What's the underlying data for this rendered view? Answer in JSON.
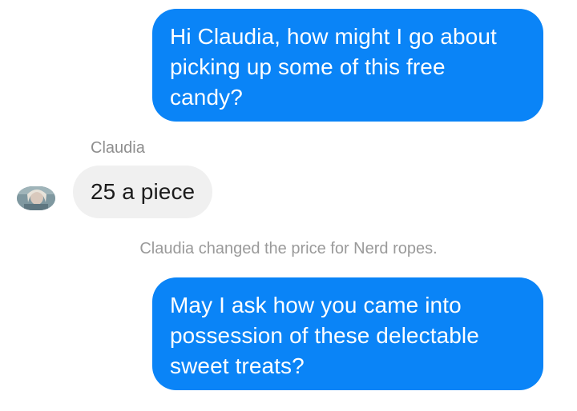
{
  "conversation": {
    "messages": [
      {
        "direction": "outgoing",
        "lines": [
          "Hi Claudia, how might I go about",
          "picking up some of this free",
          "candy?"
        ]
      },
      {
        "direction": "incoming",
        "sender": "Claudia",
        "text": "25 a piece"
      },
      {
        "direction": "outgoing",
        "lines": [
          "May I ask how you came into",
          "possession of these delectable",
          "sweet treats?"
        ]
      }
    ],
    "system_note": "Claudia changed the price for Nerd ropes."
  },
  "colors": {
    "outgoing_bubble": "#0a84f7",
    "incoming_bubble": "#f0f0f0",
    "meta_text": "#9a9a9a"
  },
  "icons": {
    "avatar": "contact-avatar-photo"
  }
}
